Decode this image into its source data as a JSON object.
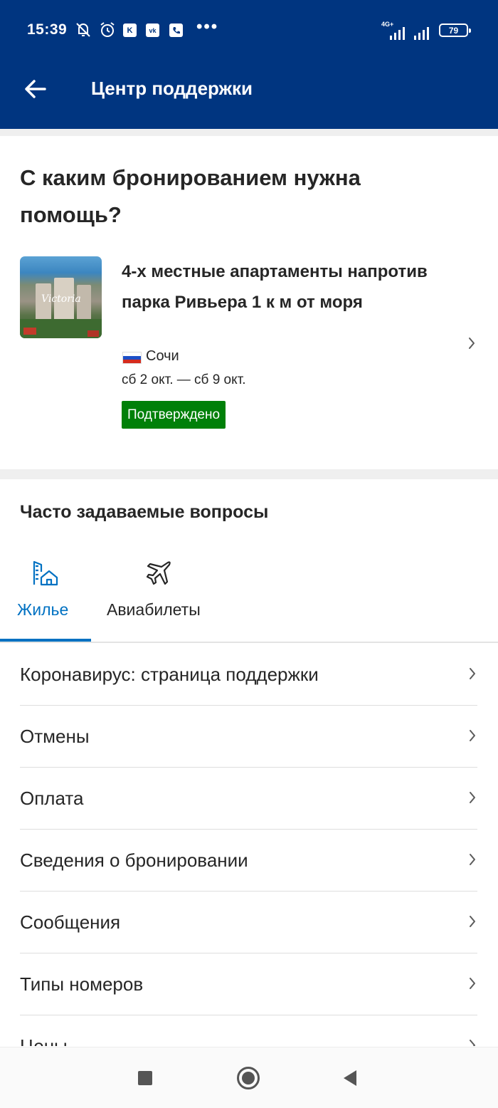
{
  "status_bar": {
    "time": "15:39",
    "app_icons": [
      "K",
      "vk",
      "phone"
    ],
    "more": "•••",
    "network": "4G+",
    "battery": "79"
  },
  "app_bar": {
    "title": "Центр поддержки",
    "back_icon": "arrow-left-icon",
    "background": "#003580"
  },
  "question": {
    "title": "С каким бронированием нужна помощь?"
  },
  "booking": {
    "name": "4-х местные апартаменты напротив парка Ривьера 1 к м от моря",
    "image_logo": "Victoria",
    "city": "Сочи",
    "country_flag": "russia-flag-icon",
    "dates": "сб 2 окт. — сб 9 окт.",
    "status": "Подтверждено",
    "status_color": "#008009"
  },
  "faq": {
    "title": "Часто задаваемые вопросы",
    "tabs": [
      {
        "label": "Жилье",
        "icon": "house-building-icon",
        "active": true
      },
      {
        "label": "Авиабилеты",
        "icon": "airplane-icon",
        "active": false
      }
    ],
    "active_color": "#0071c2",
    "items": [
      {
        "label": "Коронавирус: страница поддержки"
      },
      {
        "label": "Отмены"
      },
      {
        "label": "Оплата"
      },
      {
        "label": "Сведения о бронировании"
      },
      {
        "label": "Сообщения"
      },
      {
        "label": "Типы номеров"
      },
      {
        "label": "Цены"
      }
    ]
  },
  "nav_bar": {
    "buttons": [
      "recents-square-icon",
      "home-circle-icon",
      "back-triangle-icon"
    ]
  }
}
